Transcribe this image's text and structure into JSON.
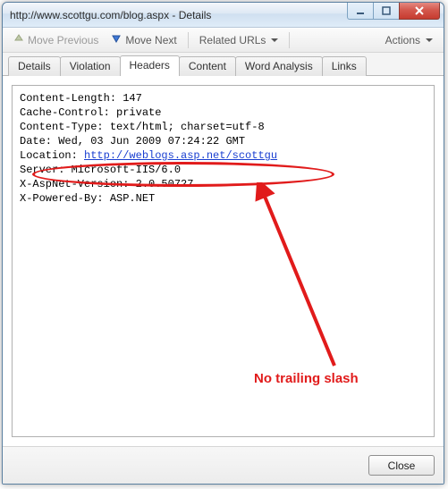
{
  "window": {
    "title": "http://www.scottgu.com/blog.aspx - Details"
  },
  "toolbar": {
    "move_previous": "Move Previous",
    "move_next": "Move Next",
    "related_urls": "Related URLs",
    "actions": "Actions"
  },
  "tabs": {
    "items": [
      {
        "label": "Details"
      },
      {
        "label": "Violation"
      },
      {
        "label": "Headers",
        "active": true
      },
      {
        "label": "Content"
      },
      {
        "label": "Word Analysis"
      },
      {
        "label": "Links"
      }
    ]
  },
  "headers": {
    "lines": [
      "Content-Length: 147",
      "Cache-Control: private",
      "Content-Type: text/html; charset=utf-8",
      "Date: Wed, 03 Jun 2009 07:24:22 GMT"
    ],
    "location_label": "Location: ",
    "location_url": "http://weblogs.asp.net/scottgu",
    "lines2": [
      "Server: Microsoft-IIS/6.0",
      "X-AspNet-Version: 2.0.50727",
      "X-Powered-By: ASP.NET"
    ]
  },
  "annotation": {
    "text": "No trailing slash",
    "color": "#e11b1b"
  },
  "footer": {
    "close": "Close"
  }
}
